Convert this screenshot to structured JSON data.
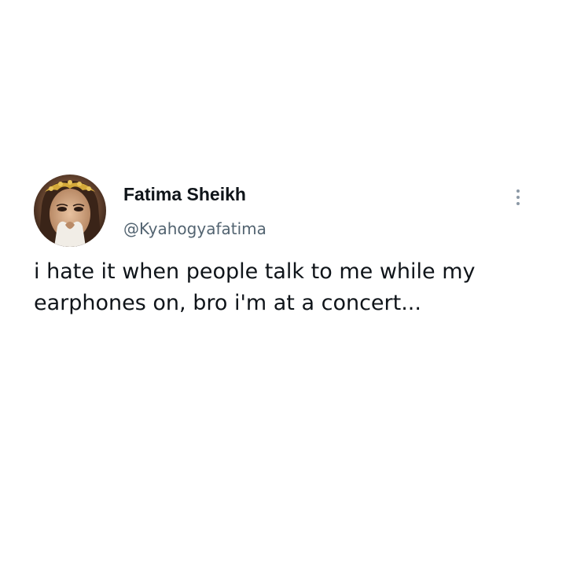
{
  "tweet": {
    "author": {
      "display_name": "Fatima Sheikh",
      "handle": "@Kyahogyafatima",
      "avatar_description": "profile photo"
    },
    "text": "i hate it when people talk to me while my earphones on, bro i'm at a concert...",
    "more_icon": "more-vertical-icon"
  },
  "colors": {
    "background": "#ffffff",
    "name": "#0f1419",
    "handle": "#536471",
    "text": "#0f1419",
    "icon": "#8b98a5"
  }
}
